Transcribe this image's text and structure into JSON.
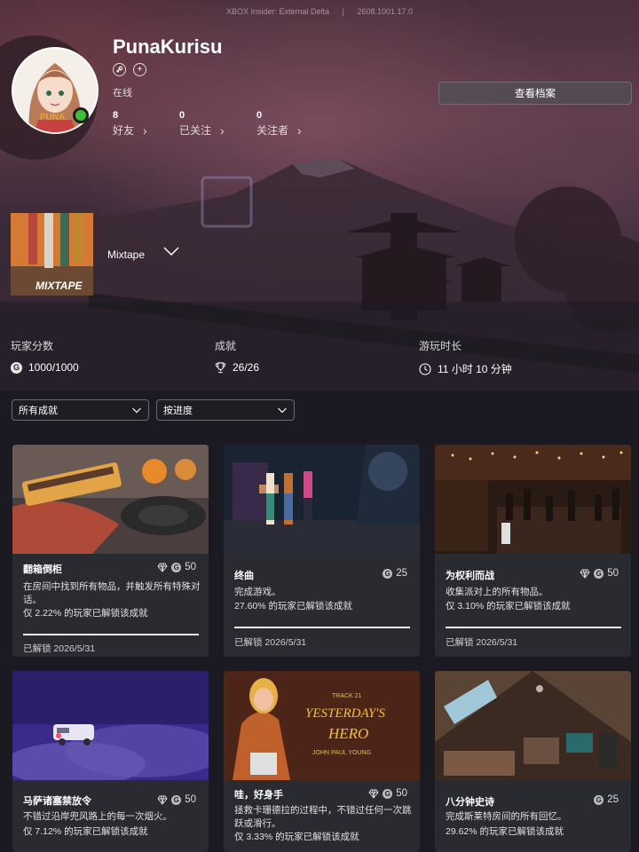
{
  "topbar": {
    "build_name": "XBOX Insider: External Delta",
    "separator": "|",
    "build_number": "2608.1001.17.0"
  },
  "profile": {
    "username": "PunaKurisu",
    "status": "在线",
    "avatar_badge": "PUNA",
    "view_profile_label": "查看档案",
    "stats": [
      {
        "count": "8",
        "label": "好友"
      },
      {
        "count": "0",
        "label": "已关注"
      },
      {
        "count": "0",
        "label": "关注者"
      }
    ]
  },
  "game": {
    "title": "Mixtape",
    "art_text": "MIXTAPE"
  },
  "summary": {
    "gamerscore_label": "玩家分数",
    "gamerscore_value": "1000/1000",
    "achievements_label": "成就",
    "achievements_value": "26/26",
    "playtime_label": "游玩时长",
    "playtime_value": "11 小时 10 分钟"
  },
  "filters": {
    "filter_selected": "所有成就",
    "sort_selected": "按进度"
  },
  "achievements": [
    {
      "title": "翻箱倒柜",
      "score": "50",
      "rare": true,
      "desc": "在房间中找到所有物品，并触发所有特殊对话。",
      "rarity": "仅 2.22% 的玩家已解锁该成就",
      "unlocked": "已解锁 2026/5/31"
    },
    {
      "title": "终曲",
      "score": "25",
      "rare": false,
      "desc": "完成游戏。",
      "rarity": "27.60% 的玩家已解锁该成就",
      "unlocked": "已解锁 2026/5/31"
    },
    {
      "title": "为权利而战",
      "score": "50",
      "rare": true,
      "desc": "收集派对上的所有物品。",
      "rarity": "仅 3.10% 的玩家已解锁该成就",
      "unlocked": "已解锁 2026/5/31"
    },
    {
      "title": "马萨诸塞禁放令",
      "score": "50",
      "rare": true,
      "desc": "不错过沿岸兜风路上的每一次烟火。",
      "rarity": "仅 7.12% 的玩家已解锁该成就",
      "unlocked": ""
    },
    {
      "title": "哇，好身手",
      "score": "50",
      "rare": true,
      "desc": "拯救卡珊德拉的过程中，不错过任何一次跳跃或滑行。",
      "rarity": "仅 3.33% 的玩家已解锁该成就",
      "unlocked": ""
    },
    {
      "title": "八分钟史诗",
      "score": "25",
      "rare": false,
      "desc": "完成斯莱特房间的所有回忆。",
      "rarity": "29.62% 的玩家已解锁该成就",
      "unlocked": ""
    }
  ],
  "art_text": {
    "track": "TRACK 21",
    "song": "YESTERDAY'S",
    "song2": "HERO",
    "artist": "JOHN PAUL YOUNG"
  },
  "icons": [
    "steam-icon",
    "add-icon",
    "chevron-right-icon",
    "chevron-down-icon",
    "gamerscore-icon",
    "trophy-icon",
    "clock-icon",
    "diamond-icon"
  ],
  "colors": {
    "presence_online": "#3ec13a",
    "card_bg": "#2a2a31",
    "page_bg": "#1b1a22"
  }
}
